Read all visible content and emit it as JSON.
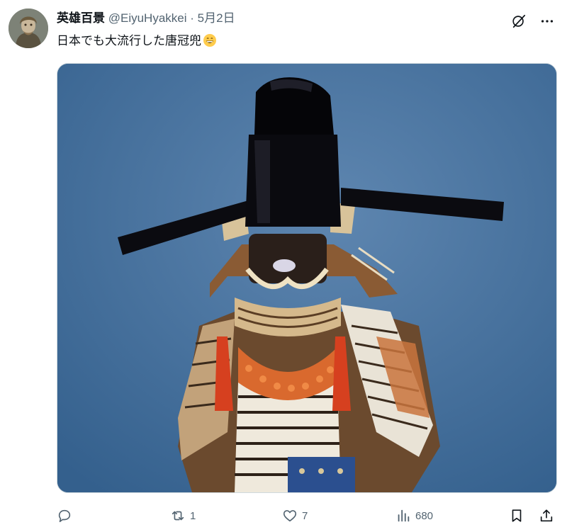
{
  "post": {
    "author_name": "英雄百景",
    "author_handle": "@EiyuHyakkei",
    "separator": "·",
    "date": "5月2日",
    "text": "日本でも大流行した唐冠兜",
    "emoji": "grinning-face-emoji",
    "media_description_icon": "samurai-armor-photo"
  },
  "header_icons": [
    "grok-icon",
    "more-icon"
  ],
  "actions": {
    "reply_count": "",
    "repost_count": "1",
    "like_count": "7",
    "views_count": "680"
  },
  "colors": {
    "text": "#0f1419",
    "secondary": "#536471",
    "photo_background": "#3f6c98"
  }
}
